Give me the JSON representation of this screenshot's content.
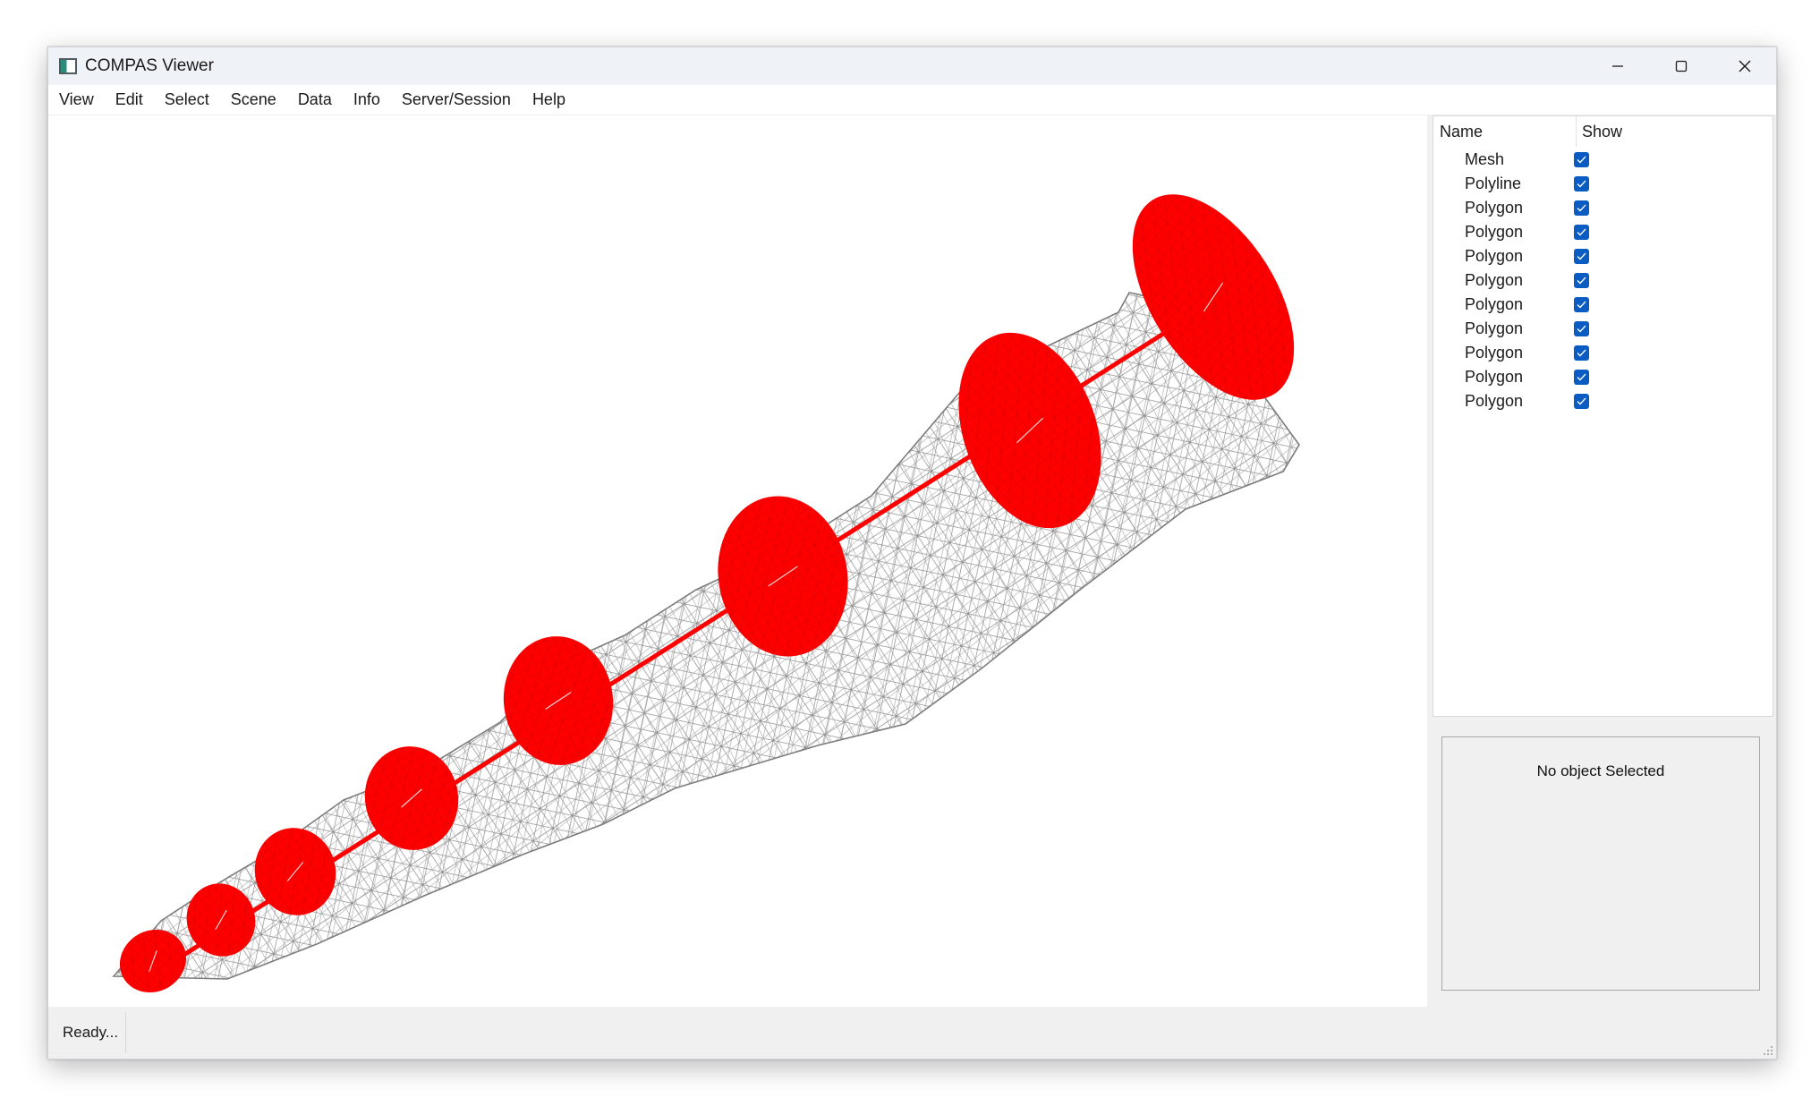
{
  "window": {
    "title": "COMPAS Viewer",
    "icon": "app-window-icon",
    "controls": [
      "minimize-icon",
      "maximize-icon",
      "close-icon"
    ]
  },
  "menu": {
    "items": [
      "View",
      "Edit",
      "Select",
      "Scene",
      "Data",
      "Info",
      "Server/Session",
      "Help"
    ]
  },
  "scene_tree": {
    "headers": {
      "name": "Name",
      "show": "Show"
    },
    "objects": [
      {
        "name": "Mesh",
        "show": true
      },
      {
        "name": "Polyline",
        "show": true
      },
      {
        "name": "Polygon",
        "show": true
      },
      {
        "name": "Polygon",
        "show": true
      },
      {
        "name": "Polygon",
        "show": true
      },
      {
        "name": "Polygon",
        "show": true
      },
      {
        "name": "Polygon",
        "show": true
      },
      {
        "name": "Polygon",
        "show": true
      },
      {
        "name": "Polygon",
        "show": true
      },
      {
        "name": "Polygon",
        "show": true
      },
      {
        "name": "Polygon",
        "show": true
      }
    ]
  },
  "properties": {
    "message": "No object Selected"
  },
  "status": {
    "text": "Ready..."
  },
  "colors": {
    "polygon_fill": "#ff0000",
    "polyline": "#ff0000",
    "mesh_wire": "#7a7a7a",
    "checkbox": "#0a5cc2"
  }
}
